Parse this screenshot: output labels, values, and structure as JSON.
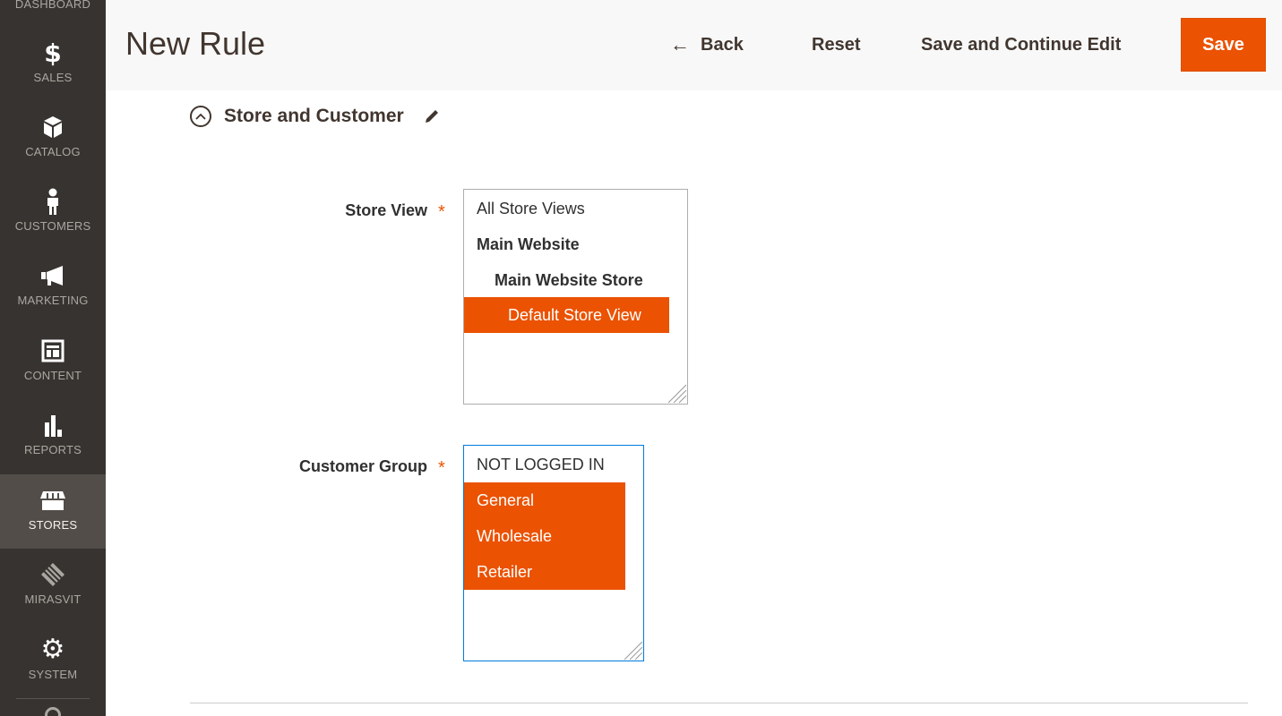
{
  "sidebar": {
    "top_partial_label": "DASHBOARD",
    "items": [
      {
        "label": "SALES",
        "icon": "dollar-icon"
      },
      {
        "label": "CATALOG",
        "icon": "box-icon"
      },
      {
        "label": "CUSTOMERS",
        "icon": "person-icon"
      },
      {
        "label": "MARKETING",
        "icon": "megaphone-icon"
      },
      {
        "label": "CONTENT",
        "icon": "layout-icon"
      },
      {
        "label": "REPORTS",
        "icon": "bar-chart-icon"
      },
      {
        "label": "STORES",
        "icon": "storefront-icon",
        "active": true
      },
      {
        "label": "MIRASVIT",
        "icon": "mirasvit-logo-icon"
      },
      {
        "label": "SYSTEM",
        "icon": "gear-icon"
      }
    ]
  },
  "header": {
    "title": "New Rule",
    "back_label": "Back",
    "reset_label": "Reset",
    "save_continue_label": "Save and Continue Edit",
    "save_label": "Save"
  },
  "section": {
    "title": "Store and Customer"
  },
  "store_view": {
    "label": "Store View",
    "required_mark": "*",
    "options": [
      {
        "label": "All Store Views",
        "level": 0,
        "group": false,
        "selected": false
      },
      {
        "label": "Main Website",
        "level": 0,
        "group": true,
        "selected": false
      },
      {
        "label": "Main Website Store",
        "level": 1,
        "group": true,
        "selected": false
      },
      {
        "label": "Default Store View",
        "level": 2,
        "group": false,
        "selected": true
      }
    ]
  },
  "customer_group": {
    "label": "Customer Group",
    "required_mark": "*",
    "options": [
      {
        "label": "NOT LOGGED IN",
        "selected": false
      },
      {
        "label": "General",
        "selected": true
      },
      {
        "label": "Wholesale",
        "selected": true
      },
      {
        "label": "Retailer",
        "selected": true
      }
    ]
  },
  "colors": {
    "accent": "#eb5202",
    "sidebar_bg": "#373330",
    "sidebar_active_bg": "#524d49",
    "focus_border": "#007bdb"
  }
}
